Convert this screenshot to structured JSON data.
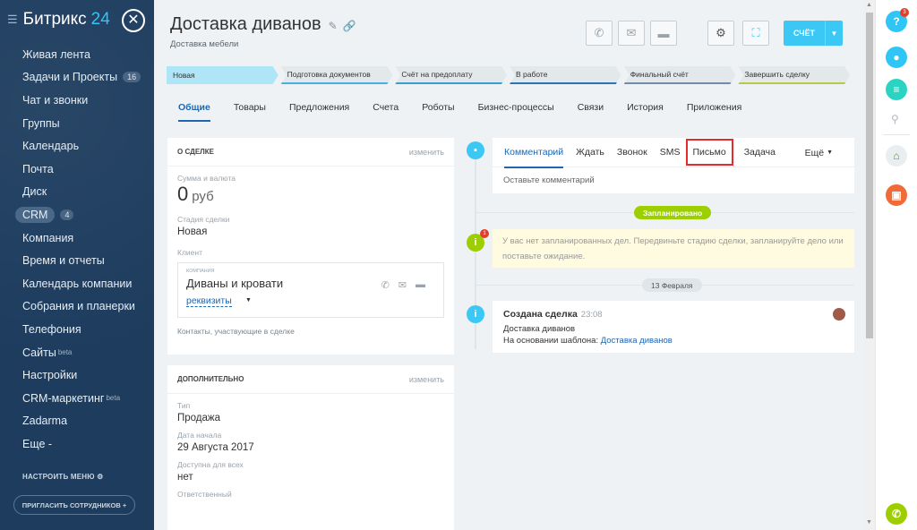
{
  "brand": {
    "name": "Битрикс",
    "number": "24"
  },
  "sidebar": {
    "items": [
      {
        "label": "Живая лента"
      },
      {
        "label": "Задачи и Проекты",
        "badge": "16"
      },
      {
        "label": "Чат и звонки"
      },
      {
        "label": "Группы"
      },
      {
        "label": "Календарь"
      },
      {
        "label": "Почта"
      },
      {
        "label": "Диск"
      },
      {
        "label": "CRM",
        "badge": "4"
      },
      {
        "label": "Компания"
      },
      {
        "label": "Время и отчеты"
      },
      {
        "label": "Календарь компании"
      },
      {
        "label": "Собрания и планерки"
      },
      {
        "label": "Телефония"
      },
      {
        "label": "Сайты",
        "sup": "beta"
      },
      {
        "label": "Настройки"
      },
      {
        "label": "CRM-маркетинг",
        "sup": "beta"
      },
      {
        "label": "Zadarma"
      },
      {
        "label": "Еще -"
      }
    ],
    "setup_menu": "НАСТРОИТЬ МЕНЮ",
    "invite": "ПРИГЛАСИТЬ СОТРУДНИКОВ +"
  },
  "deal": {
    "title": "Доставка диванов",
    "subtitle": "Доставка мебели",
    "bill_button": "СЧЁТ"
  },
  "stages": [
    "Новая",
    "Подготовка документов",
    "Счёт на предоплату",
    "В работе",
    "Финальный счёт",
    "Завершить сделку"
  ],
  "tabs": [
    "Общие",
    "Товары",
    "Предложения",
    "Счета",
    "Роботы",
    "Бизнес-процессы",
    "Связи",
    "История",
    "Приложения"
  ],
  "about": {
    "header": "О СДЕЛКЕ",
    "edit": "изменить",
    "amount_label": "Сумма и валюта",
    "amount": "0",
    "currency": "руб",
    "stage_label": "Стадия сделки",
    "stage_value": "Новая",
    "client_label": "Клиент",
    "client_type": "КОМПАНИЯ",
    "client_name": "Диваны и кровати",
    "requisites": "реквизиты",
    "contacts_note": "Контакты, участвующие в сделке"
  },
  "extra": {
    "header": "ДОПОЛНИТЕЛЬНО",
    "edit": "изменить",
    "type_label": "Тип",
    "type_value": "Продажа",
    "start_label": "Дата начала",
    "start_value": "29 Августа 2017",
    "public_label": "Доступна для всех",
    "public_value": "нет",
    "resp_label": "Ответственный"
  },
  "composer": {
    "tabs": [
      "Комментарий",
      "Ждать",
      "Звонок",
      "SMS",
      "Письмо",
      "Задача"
    ],
    "more": "Ещё",
    "hint": "Оставьте комментарий"
  },
  "timeline": {
    "planned": "Запланировано",
    "notice": "У вас нет запланированных дел. Передвиньте стадию сделки, запланируйте дело или поставьте ожидание.",
    "notice_badge": "1",
    "date": "13 Февраля",
    "event_title": "Создана сделка",
    "event_time": "23:08",
    "event_line1": "Доставка диванов",
    "event_line2_prefix": "На основании шаблона:",
    "event_line2_link": "Доставка диванов"
  },
  "right_panel": {
    "help_badge": "3"
  },
  "colors": {
    "sidebar": "#1d3c5e",
    "accent": "#3bc8f5",
    "link": "#2067b0",
    "planned": "#9dcf00",
    "highlight_box": "#e62b2b"
  }
}
